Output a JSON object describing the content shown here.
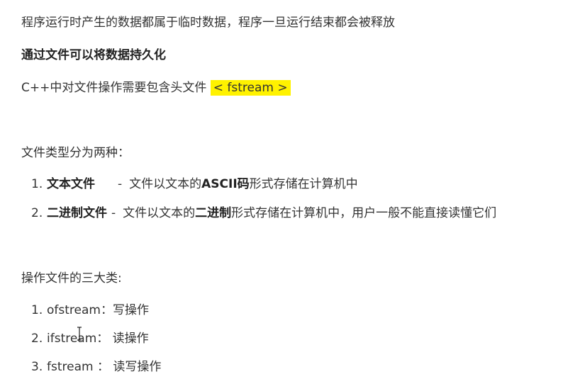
{
  "paragraphs": {
    "p1": "程序运行时产生的数据都属于临时数据，程序一旦运行结束都会被释放",
    "p2_prefix": "通过",
    "p2_bold": "文件可以将数据持久化",
    "p3_prefix": "C++中对文件操作需要包含头文件 ",
    "p3_highlight": "< fstream >",
    "types_heading": "文件类型分为两种：",
    "classes_heading": "操作文件的三大类:"
  },
  "file_types": [
    {
      "num": "1.",
      "name": "文本文件",
      "sep": "-",
      "desc_a": "文件以文本的",
      "desc_bold": "ASCII码",
      "desc_b": "形式存储在计算机中"
    },
    {
      "num": "2.",
      "name": "二进制文件",
      "sep": "-",
      "desc_a": "文件以文本的",
      "desc_bold": "二进制",
      "desc_b": "形式存储在计算机中，用户一般不能直接读懂它们"
    }
  ],
  "classes": [
    {
      "num": "1.",
      "text": "ofstream：写操作"
    },
    {
      "num": "2.",
      "text": "ifstream： 读操作"
    },
    {
      "num": "3.",
      "text": "fstream ： 读写操作"
    }
  ],
  "colors": {
    "highlight": "#fff200",
    "text": "#333333"
  },
  "cursor_icon": "text-cursor-icon"
}
